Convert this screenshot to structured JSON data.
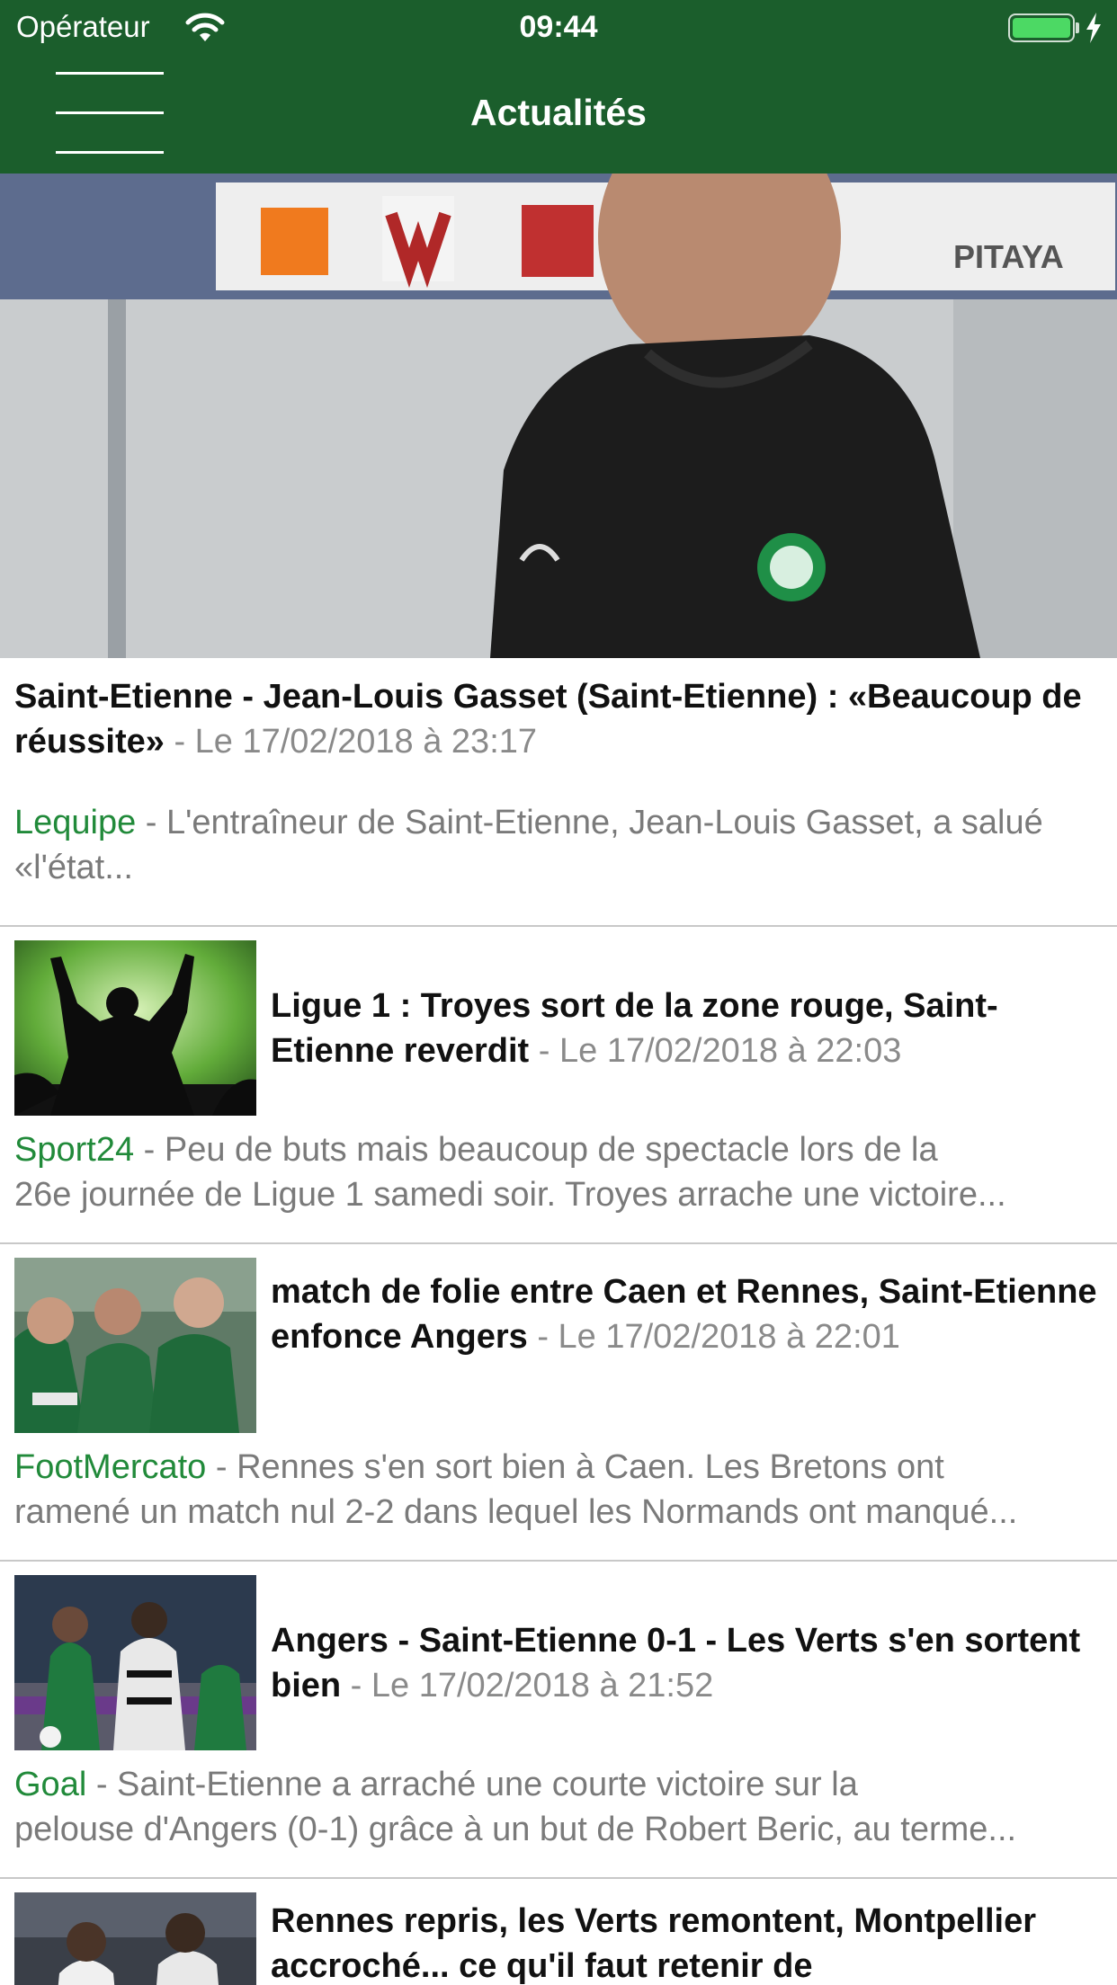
{
  "status_bar": {
    "carrier": "Opérateur",
    "time": "09:44"
  },
  "nav": {
    "title": "Actualités"
  },
  "hero": {
    "sponsor_text": "PITAYA"
  },
  "articles": [
    {
      "title": "Saint-Etienne - Jean-Louis Gasset (Saint-Etienne) : «Beaucoup de réussite»",
      "date": " - Le 17/02/2018 à 23:17",
      "source": "Lequipe",
      "excerpt": " - L'entraîneur de Saint-Etienne, Jean-Louis Gasset, a salué «l'état..."
    },
    {
      "title": "Ligue 1 : Troyes sort de la zone rouge, Saint-Etienne reverdit",
      "date": " - Le 17/02/2018 à 22:03",
      "source": "Sport24",
      "excerpt_line1": " - Peu de buts mais beaucoup de spectacle lors de la",
      "excerpt_line2": "26e journée de Ligue 1 samedi soir. Troyes arrache une victoire..."
    },
    {
      "title": "match de folie entre Caen et Rennes, Saint-Etienne enfonce Angers",
      "date": " - Le 17/02/2018 à 22:01",
      "source": "FootMercato",
      "excerpt_line1": " - Rennes s'en sort bien à Caen. Les Bretons ont",
      "excerpt_line2": "ramené un match nul 2-2 dans lequel les Normands ont manqué..."
    },
    {
      "title": "Angers - Saint-Etienne 0-1 - Les Verts s'en sortent bien",
      "date": " - Le 17/02/2018 à 21:52",
      "source": "Goal",
      "excerpt_line1": " - Saint-Etienne a arraché une courte victoire sur la",
      "excerpt_line2": "pelouse d'Angers (0-1) grâce à un but de Robert Beric, au terme..."
    },
    {
      "title": "Rennes repris, les Verts remontent, Montpellier accroché... ce qu'il faut retenir de"
    }
  ],
  "colors": {
    "header": "#1b5e2c",
    "source": "#218a3a",
    "date": "#8a8a8a",
    "excerpt": "#7a7a7a"
  }
}
